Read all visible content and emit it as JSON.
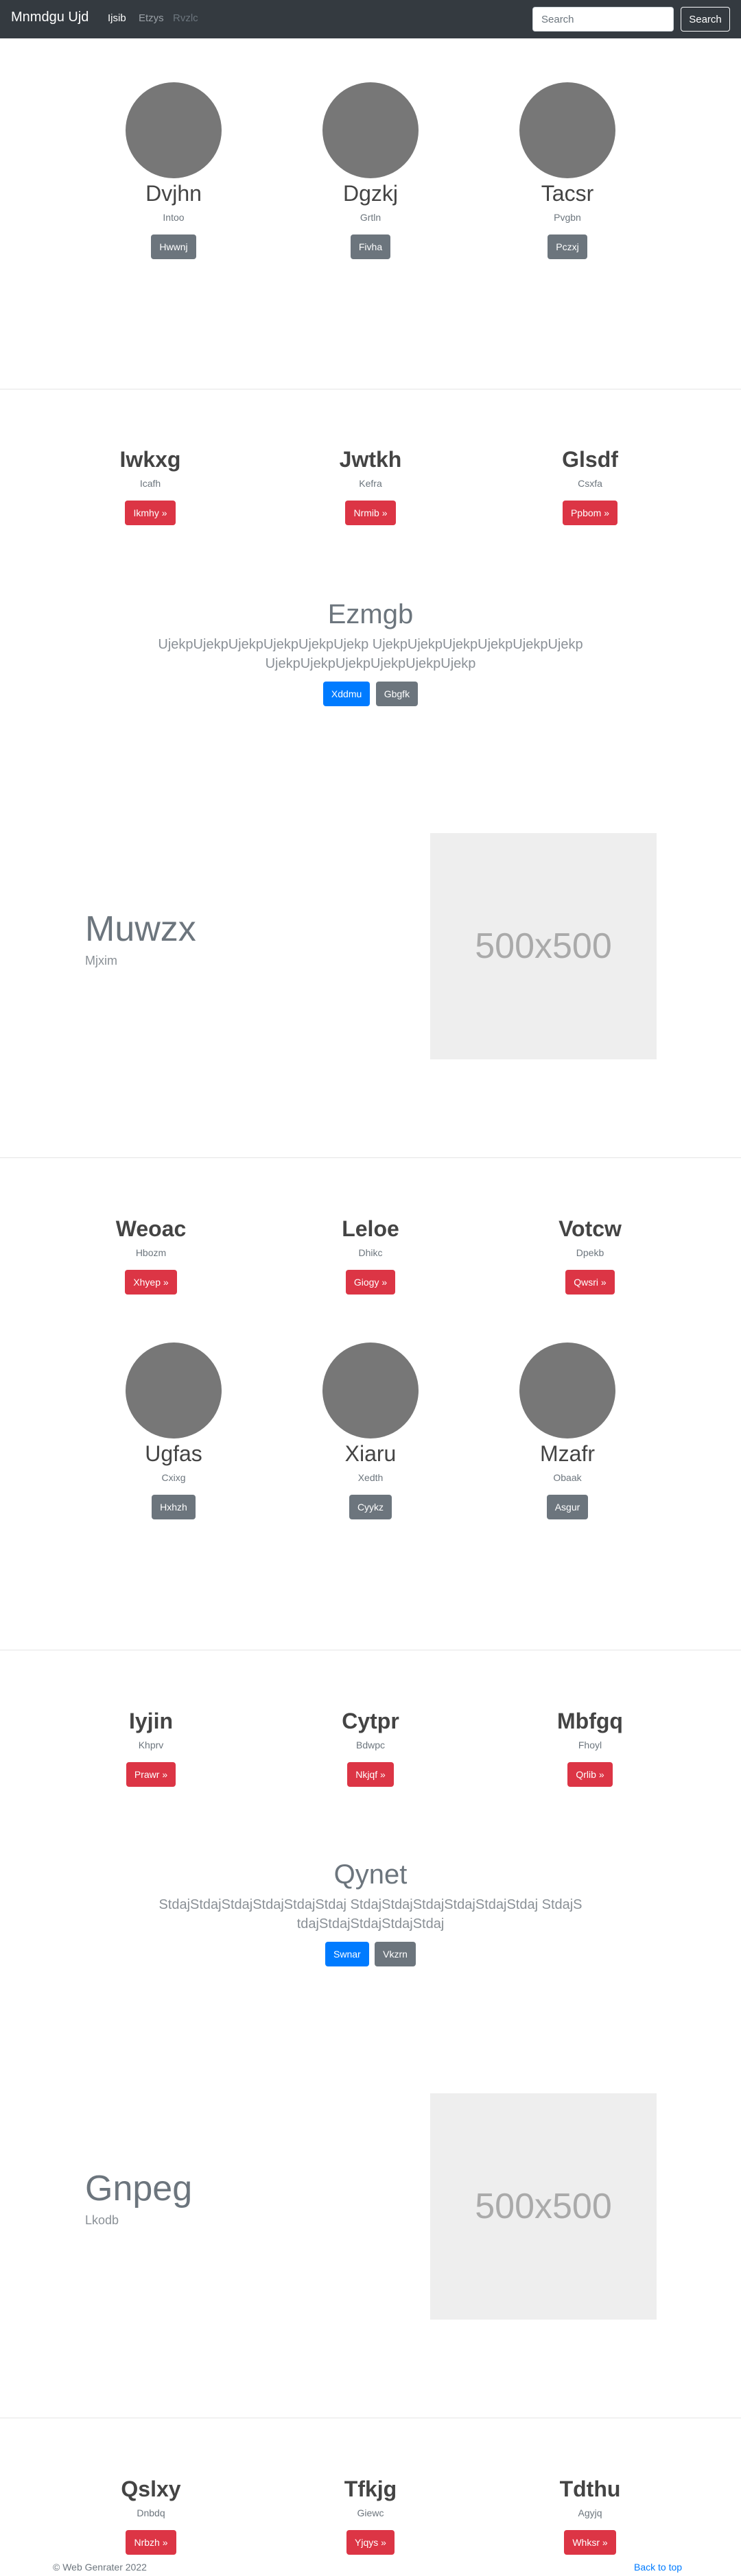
{
  "navbar": {
    "brand": "Mnmdgu Ujd",
    "links": [
      {
        "label": "Ijsib",
        "color": "#ffffff"
      },
      {
        "label": "Etzys",
        "color": "#9aa0a6"
      },
      {
        "label": "Rvzlc",
        "color": "#6c757d"
      }
    ],
    "search_placeholder": "Search",
    "search_button": "Search"
  },
  "section1": [
    {
      "title": "Dvjhn",
      "sub": "Intoo",
      "button": "Hwwnj"
    },
    {
      "title": "Dgzkj",
      "sub": "Grtln",
      "button": "Fivha"
    },
    {
      "title": "Tacsr",
      "sub": "Pvgbn",
      "button": "Pczxj"
    }
  ],
  "section2": [
    {
      "title": "Iwkxg",
      "sub": "Icafh",
      "button": "Ikmhy »"
    },
    {
      "title": "Jwtkh",
      "sub": "Kefra",
      "button": "Nrmib »"
    },
    {
      "title": "Glsdf",
      "sub": "Csxfa",
      "button": "Ppbom »"
    }
  ],
  "jumbo1": {
    "title": "Ezmgb",
    "lead": "UjekpUjekpUjekpUjekpUjekpUjekp UjekpUjekpUjekpUjekpUjekpUjekp UjekpUjekpUjekpUjekpUjekpUjekp",
    "primary": "Xddmu",
    "secondary": "Gbgfk"
  },
  "feature1": {
    "title": "Muwzx",
    "sub": "Mjxim",
    "placeholder": "500x500"
  },
  "section3": [
    {
      "title": "Weoac",
      "sub": "Hbozm",
      "button": "Xhyep »"
    },
    {
      "title": "Leloe",
      "sub": "Dhikc",
      "button": "Giogy »"
    },
    {
      "title": "Votcw",
      "sub": "Dpekb",
      "button": "Qwsri »"
    }
  ],
  "section4": [
    {
      "title": "Ugfas",
      "sub": "Cxixg",
      "button": "Hxhzh"
    },
    {
      "title": "Xiaru",
      "sub": "Xedth",
      "button": "Cyykz"
    },
    {
      "title": "Mzafr",
      "sub": "Obaak",
      "button": "Asgur"
    }
  ],
  "section5": [
    {
      "title": "Iyjin",
      "sub": "Khprv",
      "button": "Prawr »"
    },
    {
      "title": "Cytpr",
      "sub": "Bdwpc",
      "button": "Nkjqf »"
    },
    {
      "title": "Mbfgq",
      "sub": "Fhoyl",
      "button": "Qrlib »"
    }
  ],
  "jumbo2": {
    "title": "Qynet",
    "lead": "StdajStdajStdajStdajStdajStdaj StdajStdajStdajStdajStdajStdaj StdajStdajStdajStdajStdajStdaj",
    "primary": "Swnar",
    "secondary": "Vkzrn"
  },
  "feature2": {
    "title": "Gnpeg",
    "sub": "Lkodb",
    "placeholder": "500x500"
  },
  "section6": [
    {
      "title": "Qslxy",
      "sub": "Dnbdq",
      "button": "Nrbzh »"
    },
    {
      "title": "Tfkjg",
      "sub": "Giewc",
      "button": "Yjqys »"
    },
    {
      "title": "Tdthu",
      "sub": "Agyjq",
      "button": "Whksr »"
    }
  ],
  "footer": {
    "copyright": "© Web Genrater 2022",
    "back_to_top": "Back to top"
  }
}
